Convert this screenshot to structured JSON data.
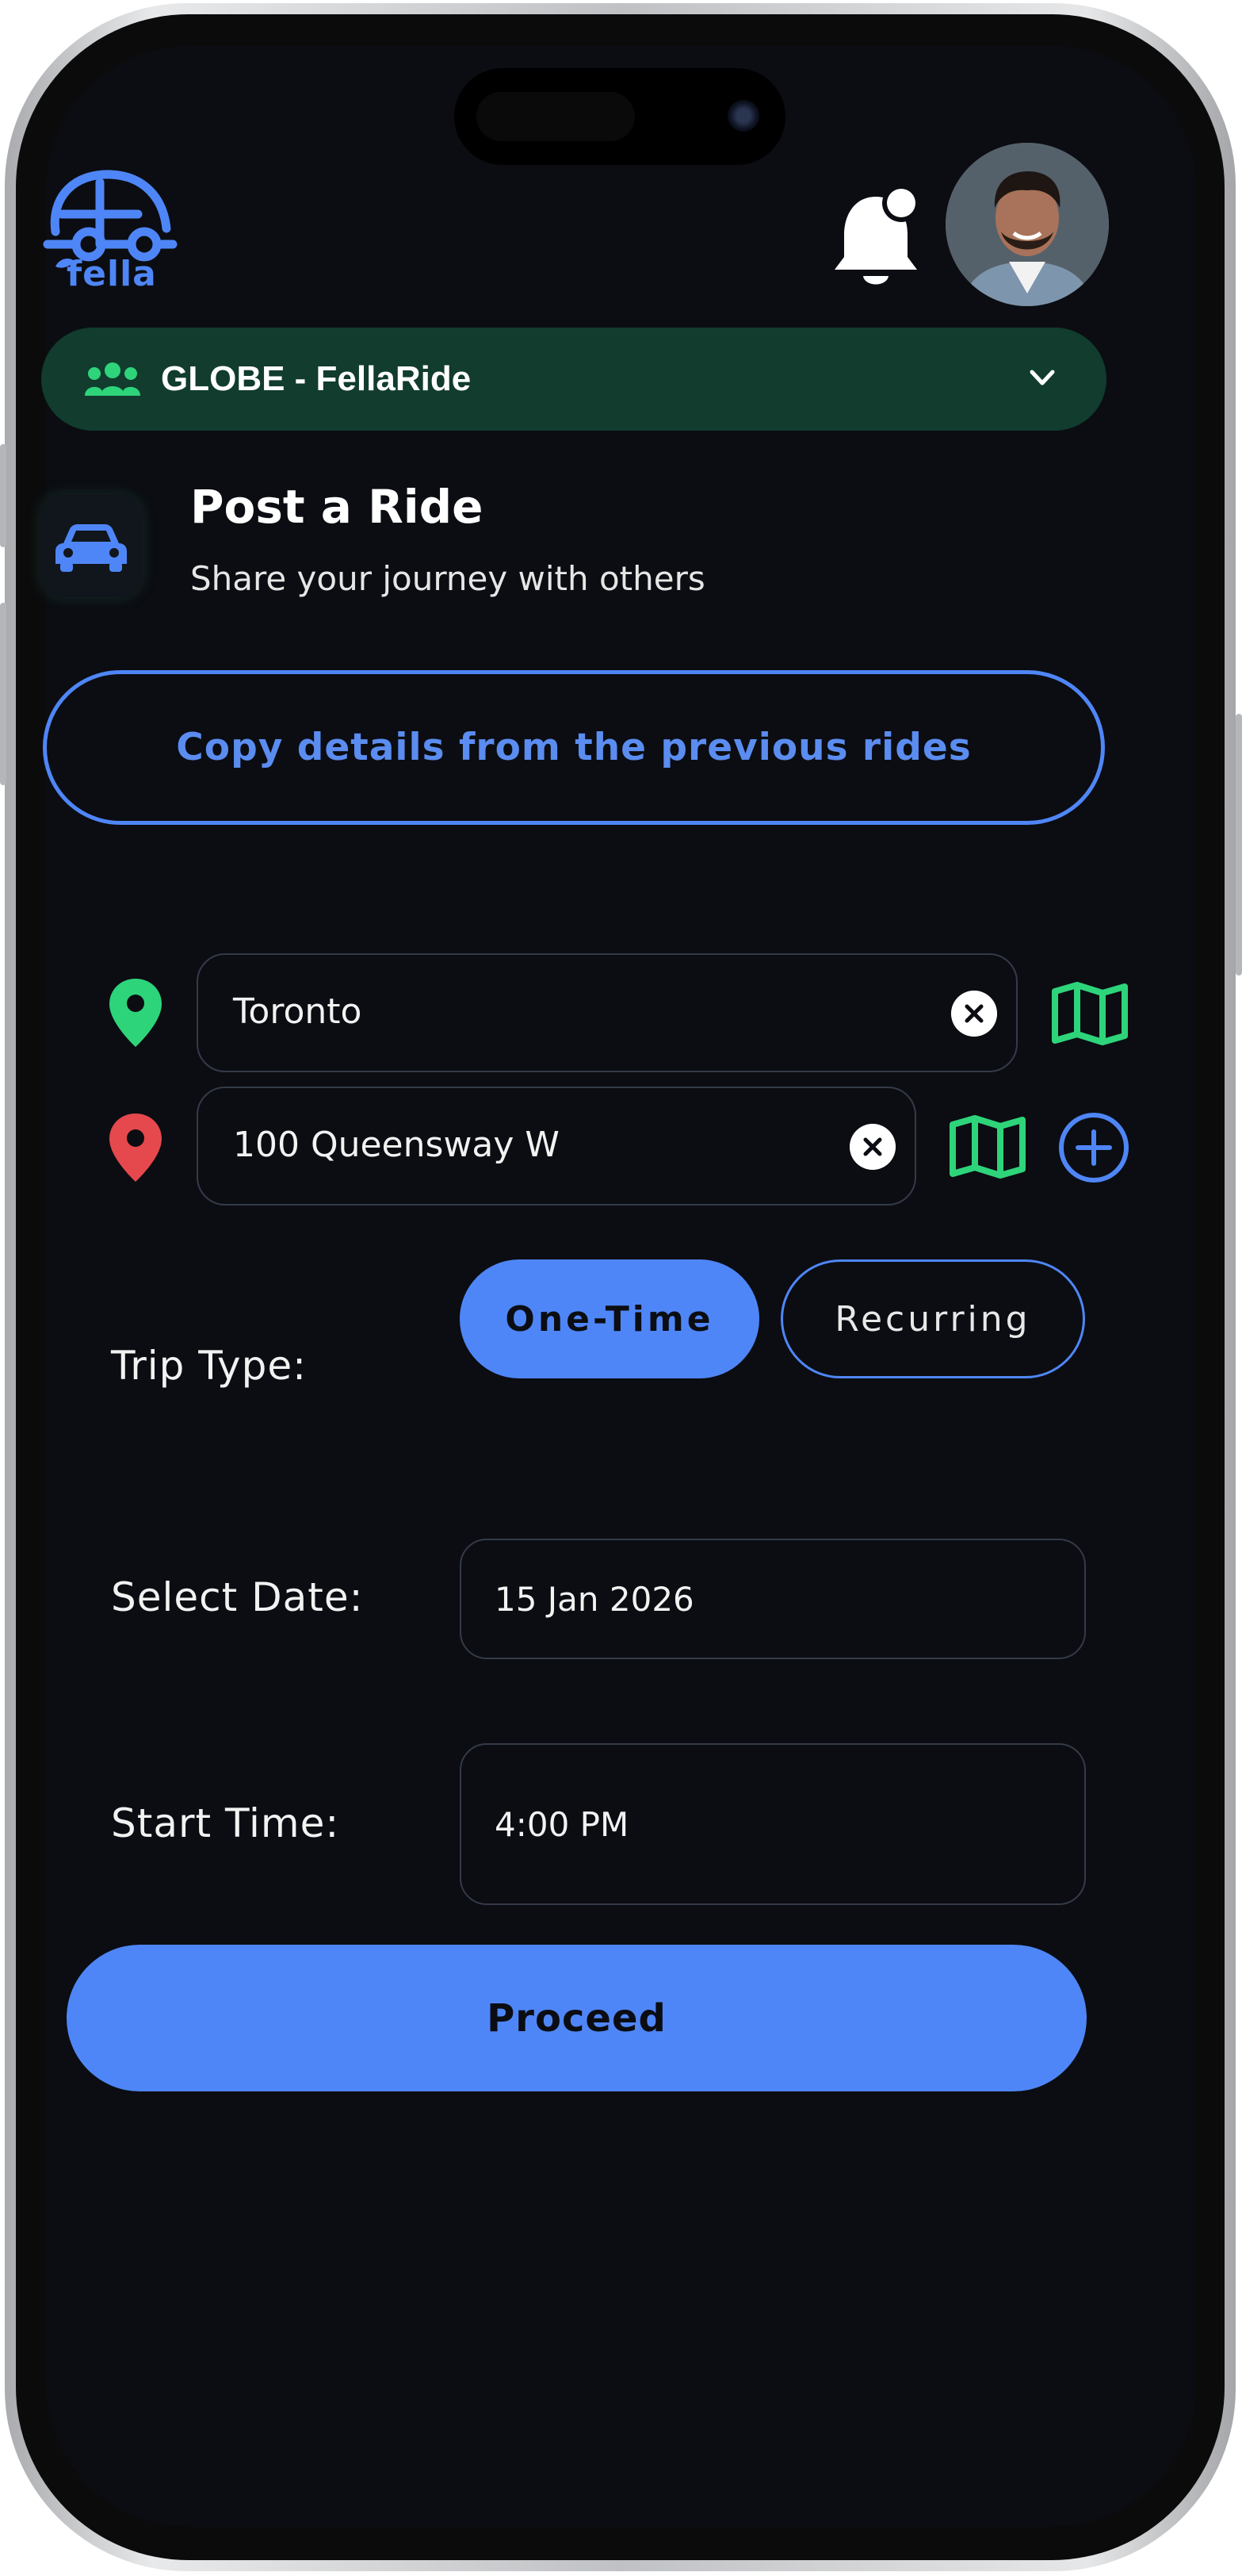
{
  "brand": {
    "logo_text": "fella",
    "accent": "#4f86f7",
    "green": "#2ed47a",
    "group_bg": "#113c2e"
  },
  "header": {
    "notification_icon": "bell-icon",
    "avatar_icon": "avatar"
  },
  "group": {
    "name": "GLOBE - FellaRide",
    "icon": "group-icon",
    "chevron": "chevron-down-icon"
  },
  "post": {
    "title": "Post a Ride",
    "subtitle": "Share your journey with others",
    "icon": "car-icon"
  },
  "copy_button": {
    "label": "Copy details from the previous rides"
  },
  "route": {
    "origin": {
      "value": "Toronto",
      "pin_color": "#2ed47a"
    },
    "destination": {
      "value": "100 Queensway W",
      "pin_color": "#e5484d"
    }
  },
  "trip_type": {
    "label": "Trip Type:",
    "options": [
      "One-Time",
      "Recurring"
    ],
    "selected": "One-Time"
  },
  "date": {
    "label": "Select Date:",
    "value": "15 Jan 2026"
  },
  "time": {
    "label": "Start Time:",
    "value": "4:00 PM"
  },
  "proceed_button": {
    "label": "Proceed"
  }
}
